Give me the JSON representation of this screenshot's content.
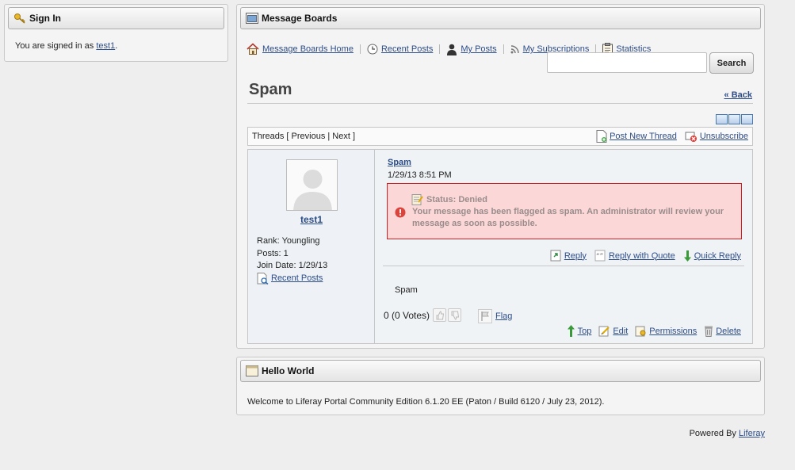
{
  "signin": {
    "title": "Sign In",
    "signed_in_text": "You are signed in as ",
    "username": "test1",
    "suffix": "."
  },
  "boards": {
    "title": "Message Boards",
    "nav": [
      {
        "label": "Message Boards Home",
        "icon": "home-icon"
      },
      {
        "label": "Recent Posts",
        "icon": "clock-icon"
      },
      {
        "label": "My Posts",
        "icon": "user-icon"
      },
      {
        "label": "My Subscriptions",
        "icon": "rss-icon"
      },
      {
        "label": "Statistics",
        "icon": "clipboard-icon"
      }
    ],
    "search": {
      "placeholder": "",
      "value": "",
      "button": "Search"
    },
    "category_title": "Spam",
    "back": "« Back",
    "threads_bar": {
      "label": "Threads [ Previous | Next ]",
      "post_new": "Post New Thread",
      "unsubscribe": "Unsubscribe"
    },
    "message": {
      "author": {
        "name": "test1",
        "rank": "Rank: Youngling",
        "posts": "Posts: 1",
        "join_date": "Join Date: 1/29/13",
        "recent_posts": "Recent Posts"
      },
      "subject": "Spam",
      "date": "1/29/13 8:51 PM",
      "status_label": "Status: Denied",
      "spam_notice": "Your message has been flagged as spam. An administrator will review your message as soon as possible.",
      "reply": "Reply",
      "reply_quote": "Reply with Quote",
      "quick_reply": "Quick Reply",
      "body": "Spam",
      "votes": "0 (0 Votes)",
      "flag": "Flag",
      "actions": {
        "top": "Top",
        "edit": "Edit",
        "permissions": "Permissions",
        "delete": "Delete"
      }
    }
  },
  "hello": {
    "title": "Hello World",
    "text": "Welcome to Liferay Portal Community Edition 6.1.20 EE (Paton / Build 6120 / July 23, 2012)."
  },
  "footer": {
    "powered_by": "Powered By ",
    "link": "Liferay"
  },
  "colors": {
    "alert_border": "#cc1f24",
    "alert_bg": "#fcd7d7",
    "link": "#2d4d88"
  }
}
